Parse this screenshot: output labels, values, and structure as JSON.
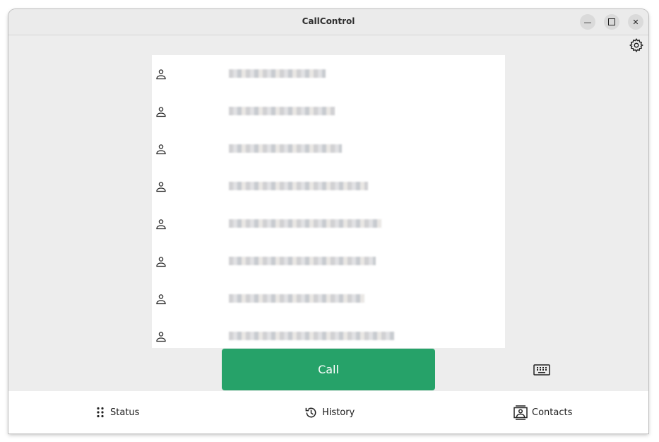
{
  "window": {
    "title": "CallControl",
    "controls": [
      "minimize-icon",
      "maximize-icon",
      "close-icon"
    ]
  },
  "settings_icon": "gear-icon",
  "contacts": {
    "row_count": 8,
    "row_icon": "person-icon",
    "names_blurred": true
  },
  "call_button": {
    "label": "Call",
    "color": "#26a269"
  },
  "keypad_icon": "keyboard-icon",
  "nav": [
    {
      "label": "Status",
      "icon": "dots-grid-icon"
    },
    {
      "label": "History",
      "icon": "history-icon"
    },
    {
      "label": "Contacts",
      "icon": "contacts-icon"
    }
  ]
}
